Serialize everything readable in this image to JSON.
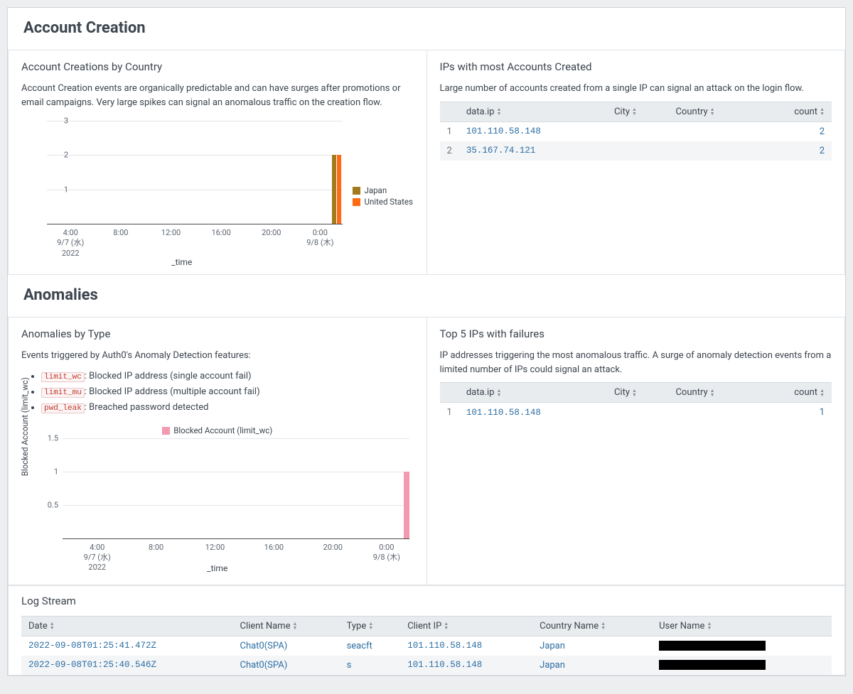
{
  "sections": {
    "account_creation": {
      "title": "Account Creation"
    },
    "anomalies": {
      "title": "Anomalies"
    }
  },
  "panel_account_by_country": {
    "title": "Account Creations by Country",
    "desc": "Account Creation events are organically predictable and can have surges after promotions or email campaigns. Very large spikes can signal an anomalous traffic on the creation flow."
  },
  "panel_ips_most_created": {
    "title": "IPs with most Accounts Created",
    "desc": "Large number of accounts created from a single IP can signal an attack on the login flow.",
    "columns": {
      "ip": "data.ip",
      "city": "City",
      "country": "Country",
      "count": "count"
    },
    "rows": [
      {
        "n": "1",
        "ip": "101.110.58.148",
        "city": "",
        "country": "",
        "count": "2"
      },
      {
        "n": "2",
        "ip": "35.167.74.121",
        "city": "",
        "country": "",
        "count": "2"
      }
    ]
  },
  "panel_anomalies_by_type": {
    "title": "Anomalies by Type",
    "desc": "Events triggered by Auth0's Anomaly Detection features:",
    "features": [
      {
        "code": "limit_wc",
        "text": ": Blocked IP address (single account fail)"
      },
      {
        "code": "limit_mu",
        "text": ": Blocked IP address (multiple account fail)"
      },
      {
        "code": "pwd_leak",
        "text": ": Breached password detected"
      }
    ]
  },
  "panel_top5_ips": {
    "title": "Top 5 IPs with failures",
    "desc": "IP addresses triggering the most anomalous traffic. A surge of anomaly detection events from a limited number of IPs could signal an attack.",
    "columns": {
      "ip": "data.ip",
      "city": "City",
      "country": "Country",
      "count": "count"
    },
    "rows": [
      {
        "n": "1",
        "ip": "101.110.58.148",
        "city": "",
        "country": "",
        "count": "1"
      }
    ]
  },
  "panel_log_stream": {
    "title": "Log Stream",
    "columns": {
      "date": "Date",
      "client_name": "Client Name",
      "type": "Type",
      "client_ip": "Client IP",
      "country_name": "Country Name",
      "user_name": "User Name"
    },
    "rows": [
      {
        "date": "2022-09-08T01:25:41.472Z",
        "client_name": "Chat0(SPA)",
        "type": "seacft",
        "client_ip": "101.110.58.148",
        "country_name": "Japan",
        "user_name": ""
      },
      {
        "date": "2022-09-08T01:25:40.546Z",
        "client_name": "Chat0(SPA)",
        "type": "s",
        "client_ip": "101.110.58.148",
        "country_name": "Japan",
        "user_name": ""
      }
    ]
  },
  "chart_data": [
    {
      "id": "account_creations_by_country",
      "type": "bar",
      "xlabel": "_time",
      "ylabel": "",
      "ylim": [
        0,
        3
      ],
      "yticks": [
        1,
        2,
        3
      ],
      "xticks": [
        "4:00\n9/7 (水)\n2022",
        "8:00",
        "12:00",
        "16:00",
        "20:00",
        "0:00\n9/8 (木)"
      ],
      "xtick_positions_pct": [
        8,
        25,
        42,
        59,
        76,
        92.5
      ],
      "series": [
        {
          "name": "Japan",
          "color": "#a37a1c",
          "bars": [
            {
              "x_pct": 96.5,
              "value": 2
            }
          ]
        },
        {
          "name": "United States",
          "color": "#ff6a13",
          "bars": [
            {
              "x_pct": 98.2,
              "value": 2
            }
          ]
        }
      ]
    },
    {
      "id": "anomalies_by_type",
      "type": "bar",
      "xlabel": "_time",
      "ylabel": "Blocked Account (limit_wc)",
      "ylim": [
        0,
        1.5
      ],
      "yticks": [
        0.5,
        1,
        1.5
      ],
      "xticks": [
        "4:00\n9/7 (水)\n2022",
        "8:00",
        "12:00",
        "16:00",
        "20:00",
        "0:00\n9/8 (木)"
      ],
      "xtick_positions_pct": [
        10,
        27,
        44,
        61,
        78,
        93.5
      ],
      "series": [
        {
          "name": "Blocked Account (limit_wc)",
          "color": "#f39ab0",
          "bars": [
            {
              "x_pct": 98.5,
              "value": 1
            }
          ]
        }
      ]
    }
  ],
  "colors": {
    "japan": "#a37a1c",
    "us": "#ff6a13",
    "blocked": "#f39ab0"
  }
}
